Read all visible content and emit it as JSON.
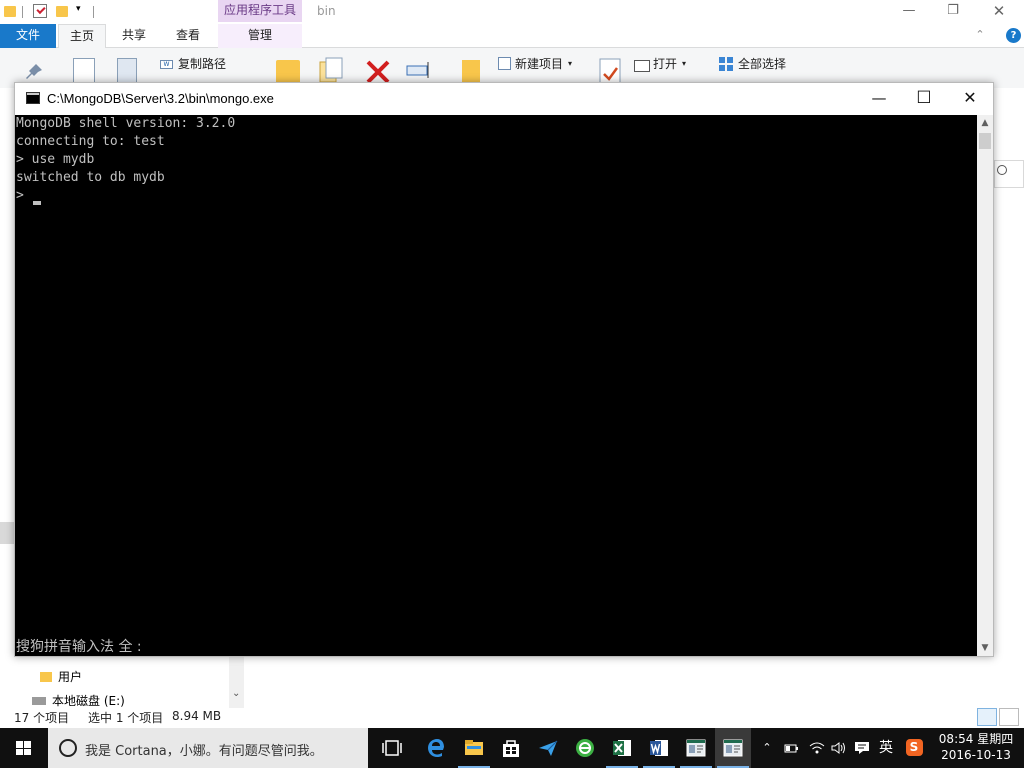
{
  "explorer": {
    "title": "bin",
    "context_tab_header": "应用程序工具",
    "ribbon_tabs": [
      "文件",
      "主页",
      "共享",
      "查看",
      "管理"
    ],
    "ribbon": {
      "copy_path": "复制路径",
      "new_item": "新建项目",
      "open": "打开",
      "select_all": "全部选择"
    },
    "nav": {
      "users_folder": "用户",
      "local_disk": "本地磁盘 (E:)"
    },
    "status": {
      "item_count": "17 个项目",
      "selected": "选中 1 个项目",
      "size": "8.94 MB"
    },
    "controls": {
      "minimize": "—",
      "restore": "❐",
      "close": "✕",
      "help": "?",
      "expand": "⌃"
    }
  },
  "console": {
    "title": "C:\\MongoDB\\Server\\3.2\\bin\\mongo.exe",
    "controls": {
      "minimize": "—",
      "maximize": "☐",
      "close": "✕"
    },
    "lines": [
      "MongoDB shell version: 3.2.0",
      "connecting to: test",
      "> use mydb",
      "switched to db mydb",
      ">"
    ],
    "ime_status": "搜狗拼音输入法 全 :",
    "scroll_up": "▲",
    "scroll_down": "▼"
  },
  "taskbar": {
    "search_placeholder": "我是 Cortana，小娜。有问题尽管问我。",
    "apps": [
      "task-view",
      "edge",
      "file-explorer",
      "store",
      "feiq",
      "360-browser",
      "excel",
      "word",
      "notepad-window",
      "console-window"
    ],
    "tray": {
      "language": "英",
      "ime": "S"
    },
    "clock": {
      "time": "08:54 星期四",
      "date": "2016-10-13"
    }
  },
  "colors": {
    "accent": "#1979ca",
    "console_bg": "#000000",
    "console_text": "#c0c0c0",
    "taskbar_bg": "#101010",
    "context_tab": "#e9d6f2"
  }
}
